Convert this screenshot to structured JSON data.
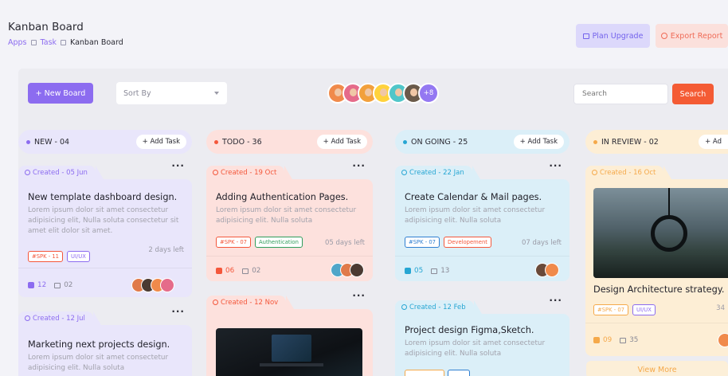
{
  "page": {
    "title": "Kanban Board"
  },
  "breadcrumb": {
    "apps": "Apps",
    "task": "Task",
    "current": "Kanban Board"
  },
  "top_buttons": {
    "plan_upgrade": "Plan Upgrade",
    "export_report": "Export Report"
  },
  "toolbar": {
    "new_board": "+ New Board",
    "sort_by": "Sort By",
    "avatars_more": "+8",
    "search_placeholder": "Search",
    "search_button": "Search"
  },
  "columns": [
    {
      "title": "NEW - 04",
      "add": "+ Add Task",
      "accent": "#8c6cf0",
      "bg": "#e9e6fb"
    },
    {
      "title": "TODO - 36",
      "add": "+ Add Task",
      "accent": "#f4573b",
      "bg": "#fde1dd"
    },
    {
      "title": "ON GOING - 25",
      "add": "+ Add Task",
      "accent": "#26a6d3",
      "bg": "#dbeff8"
    },
    {
      "title": "IN REVIEW - 02",
      "add": "+ Ad",
      "accent": "#f5a94a",
      "bg": "#fdeed5"
    }
  ],
  "cards": {
    "new1": {
      "created": "Created - 05 Jun",
      "title": "New template dashboard design.",
      "desc": [
        "Lorem ipsum dolor sit amet consectetur",
        "adipisicing elit, Nulla soluta consectetur sit",
        "amet elit dolor sit amet."
      ],
      "tags": [
        "#SPK - 11",
        "UI/UX"
      ],
      "days": "2 days left",
      "likes": "12",
      "comments": "02"
    },
    "new2": {
      "created": "Created - 12 Jul",
      "title": "Marketing next projects design.",
      "desc": [
        "Lorem ipsum dolor sit amet consectetur",
        "adipisicing elit. Nulla soluta"
      ]
    },
    "todo1": {
      "created": "Created - 19 Oct",
      "title": "Adding Authentication Pages.",
      "desc": [
        "Lorem ipsum dolor sit amet consectetur",
        "adipisicing elit. Nulla soluta"
      ],
      "tags": [
        "#SPK - 07",
        "Authentication"
      ],
      "days": "05 days left",
      "likes": "06",
      "comments": "02"
    },
    "todo2": {
      "created": "Created - 12 Nov"
    },
    "ongo1": {
      "created": "Created - 22 Jan",
      "title": "Create Calendar & Mail pages.",
      "desc": [
        "Lorem ipsum dolor sit amet consectetur",
        "adipisicing elit. Nulla soluta"
      ],
      "tags": [
        "#SPK - 07",
        "Developement"
      ],
      "days": "07 days left",
      "likes": "05",
      "comments": "13"
    },
    "ongo2": {
      "created": "Created - 12 Feb",
      "title": "Project design Figma,Sketch.",
      "desc": [
        "Lorem ipsum dolor sit amet consectetur",
        "adipisicing elit. Nulla soluta"
      ]
    },
    "rev1": {
      "created": "Created - 16 Oct",
      "title": "Design Architecture strategy.",
      "tags": [
        "#SPK - 07",
        "UI/UX"
      ],
      "days": "34",
      "likes": "09",
      "comments": "35"
    }
  },
  "view_more": "View More"
}
